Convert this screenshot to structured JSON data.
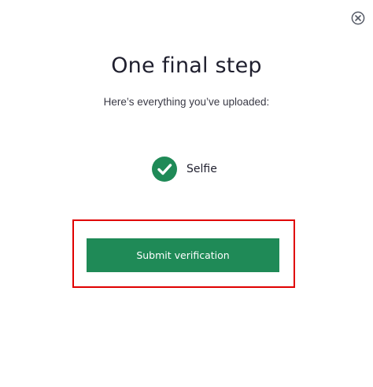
{
  "dialog": {
    "close_icon": "close-circle-icon",
    "title": "One final step",
    "subtitle": "Here’s everything you’ve uploaded:",
    "uploaded_items": [
      {
        "label": "Selfie",
        "status_icon": "check-circle-icon",
        "status_color": "#1f8a57"
      }
    ],
    "submit_label": "Submit verification",
    "colors": {
      "accent": "#1f8a57",
      "highlight_box": "#e00000"
    }
  }
}
